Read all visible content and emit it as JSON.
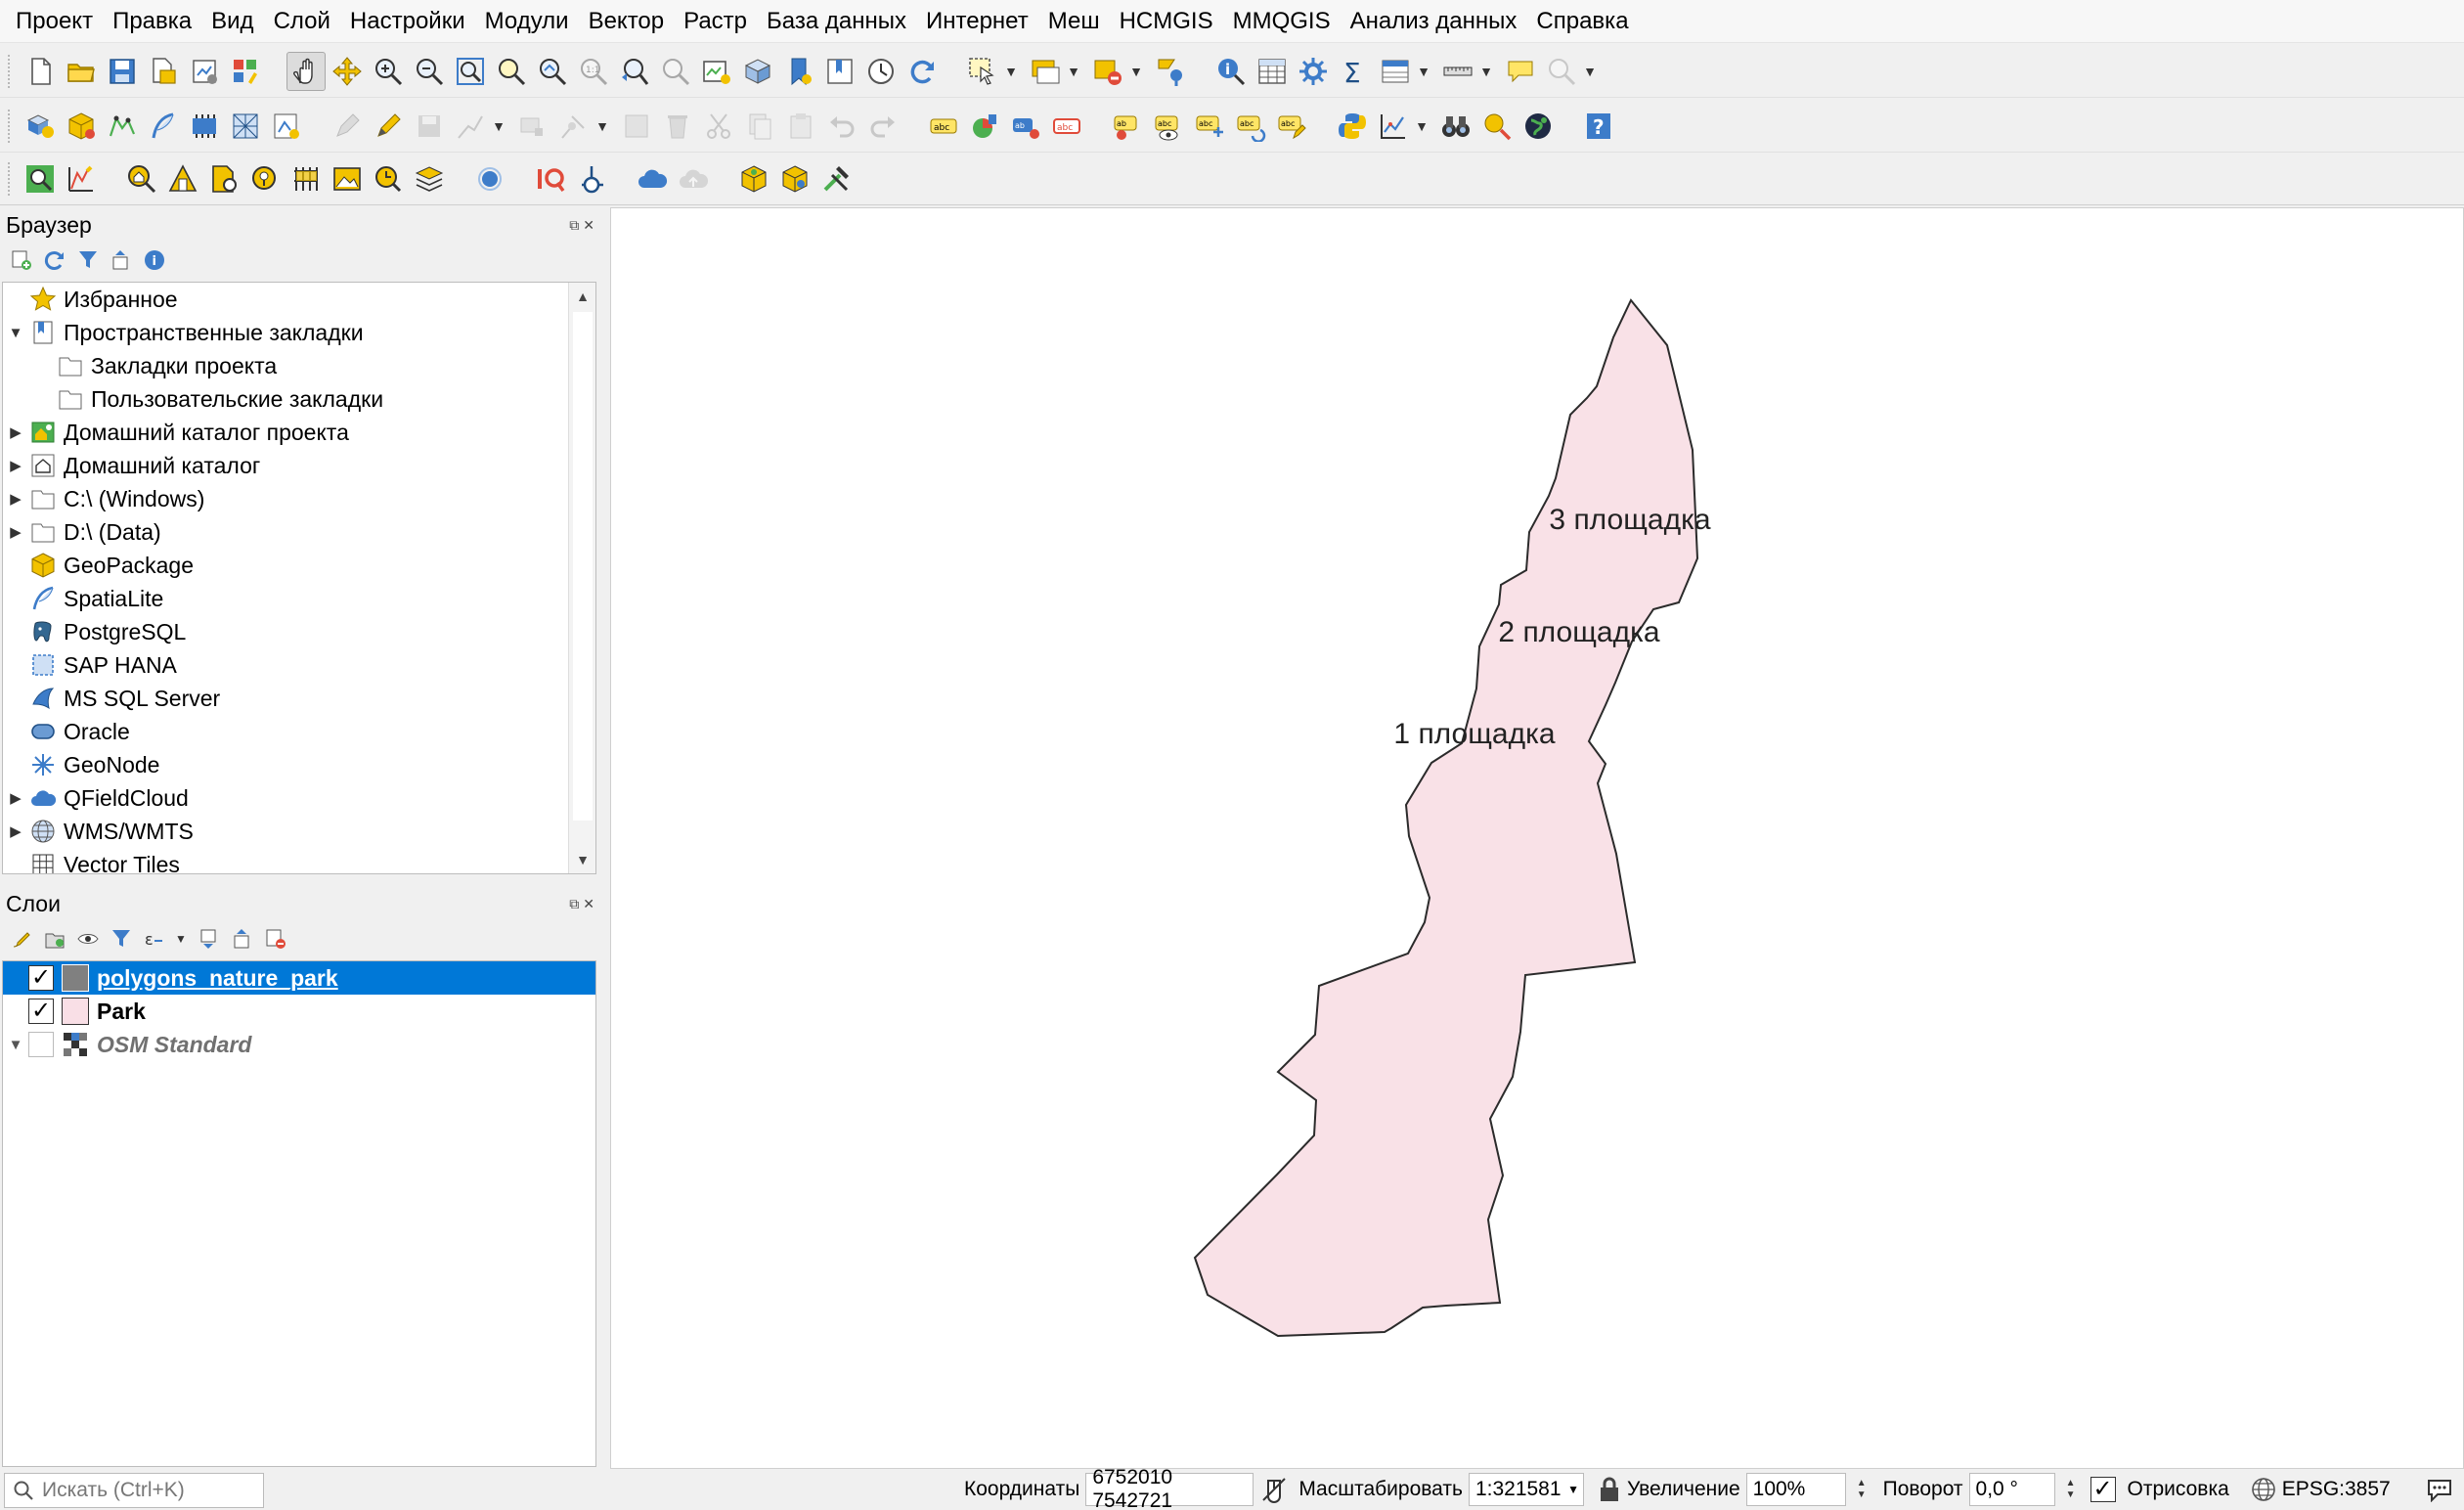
{
  "menubar": {
    "items": [
      "Проект",
      "Правка",
      "Вид",
      "Слой",
      "Настройки",
      "Модули",
      "Вектор",
      "Растр",
      "База данных",
      "Интернет",
      "Меш",
      "HCMGIS",
      "MMQGIS",
      "Анализ данных",
      "Справка"
    ]
  },
  "browser": {
    "title": "Браузер",
    "items": [
      {
        "label": "Избранное",
        "icon": "star-icon",
        "indent": 0,
        "arrow": ""
      },
      {
        "label": "Пространственные закладки",
        "icon": "bookmarks-icon",
        "indent": 0,
        "arrow": "down"
      },
      {
        "label": "Закладки проекта",
        "icon": "folder-icon",
        "indent": 1,
        "arrow": ""
      },
      {
        "label": "Пользовательские закладки",
        "icon": "folder-icon",
        "indent": 1,
        "arrow": ""
      },
      {
        "label": "Домашний каталог проекта",
        "icon": "project-home-icon",
        "indent": 0,
        "arrow": "right"
      },
      {
        "label": "Домашний каталог",
        "icon": "home-icon",
        "indent": 0,
        "arrow": "right"
      },
      {
        "label": "C:\\ (Windows)",
        "icon": "drive-icon",
        "indent": 0,
        "arrow": "right"
      },
      {
        "label": "D:\\ (Data)",
        "icon": "drive-icon",
        "indent": 0,
        "arrow": "right"
      },
      {
        "label": "GeoPackage",
        "icon": "geopackage-icon",
        "indent": 0,
        "arrow": ""
      },
      {
        "label": "SpatiaLite",
        "icon": "spatialite-icon",
        "indent": 0,
        "arrow": ""
      },
      {
        "label": "PostgreSQL",
        "icon": "postgresql-icon",
        "indent": 0,
        "arrow": ""
      },
      {
        "label": "SAP HANA",
        "icon": "sap-hana-icon",
        "indent": 0,
        "arrow": ""
      },
      {
        "label": "MS SQL Server",
        "icon": "mssql-icon",
        "indent": 0,
        "arrow": ""
      },
      {
        "label": "Oracle",
        "icon": "oracle-icon",
        "indent": 0,
        "arrow": ""
      },
      {
        "label": "GeoNode",
        "icon": "geonode-icon",
        "indent": 0,
        "arrow": ""
      },
      {
        "label": "QFieldCloud",
        "icon": "cloud-icon",
        "indent": 0,
        "arrow": "right"
      },
      {
        "label": "WMS/WMTS",
        "icon": "globe-icon",
        "indent": 0,
        "arrow": "right"
      },
      {
        "label": "Vector Tiles",
        "icon": "vector-tiles-icon",
        "indent": 0,
        "arrow": ""
      }
    ]
  },
  "layers": {
    "title": "Слои",
    "items": [
      {
        "name": "polygons_nature_park",
        "checked": true,
        "swatch": "#808080",
        "selected": true,
        "style": "sel"
      },
      {
        "name": "Park",
        "checked": true,
        "swatch": "#f9dfe6",
        "selected": false,
        "style": ""
      },
      {
        "name": "OSM Standard",
        "checked": false,
        "swatch": "",
        "selected": false,
        "style": "basemap"
      }
    ]
  },
  "map": {
    "polygon_fill": "#f9e1e7",
    "polygon_stroke": "#2b2b2b",
    "labels": [
      "3 площадка",
      "2 площадка",
      "1 площадка"
    ]
  },
  "status": {
    "search_placeholder": "Искать (Ctrl+K)",
    "coords_label": "Координаты",
    "coords_value": "6752010 7542721",
    "scale_label": "Масштабировать",
    "scale_value": "1:321581",
    "magnifier_label": "Увеличение",
    "magnifier_value": "100%",
    "rotation_label": "Поворот",
    "rotation_value": "0,0 °",
    "render_label": "Отрисовка",
    "crs_value": "EPSG:3857"
  },
  "colors": {
    "selection": "#0078d7",
    "accent_yellow": "#f2c200",
    "accent_blue": "#3d7cc9"
  }
}
